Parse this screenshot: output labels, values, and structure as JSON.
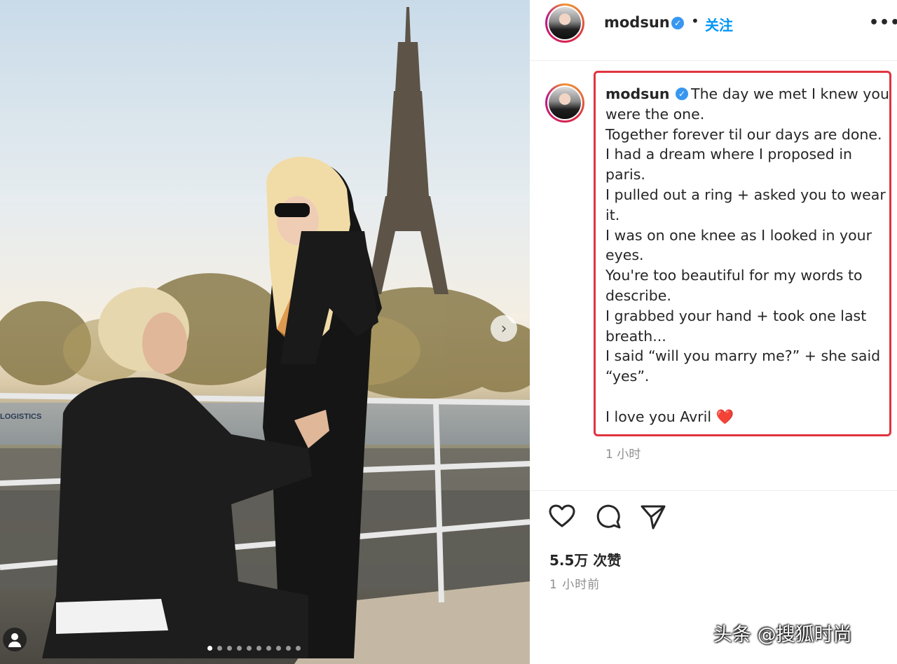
{
  "header": {
    "username": "modsun",
    "verified_mark": "✓",
    "separator": "•",
    "follow_label": "关注",
    "more_label": "•••"
  },
  "caption": {
    "username": "modsun",
    "text": "The day we met I knew you were the one.\nTogether forever til our days are done.\nI had a dream where I proposed in paris.\nI pulled out a ring + asked you to wear it.\nI was on one knee as I looked in your eyes.\nYou're too beautiful for my words to describe.\nI grabbed your hand + took one last breath...\nI said “will you marry me?” + she said “yes”.\n\nI love you Avril",
    "emoji": "❤️",
    "time": "1 小时"
  },
  "post": {
    "likes": "5.5万 次赞",
    "posted": "1 小时前"
  },
  "photo": {
    "next_label": "›",
    "carousel_count": 10,
    "active_index": 0
  },
  "watermark": "头条 @搜狐时尚",
  "colors": {
    "accent_blue": "#0095f6",
    "highlight_red": "#e0343f",
    "verified_blue": "#3897f0"
  },
  "icons": [
    "heart-icon",
    "comment-icon",
    "share-icon",
    "more-icon",
    "verified-icon",
    "user-tag-icon",
    "chevron-right-icon"
  ]
}
